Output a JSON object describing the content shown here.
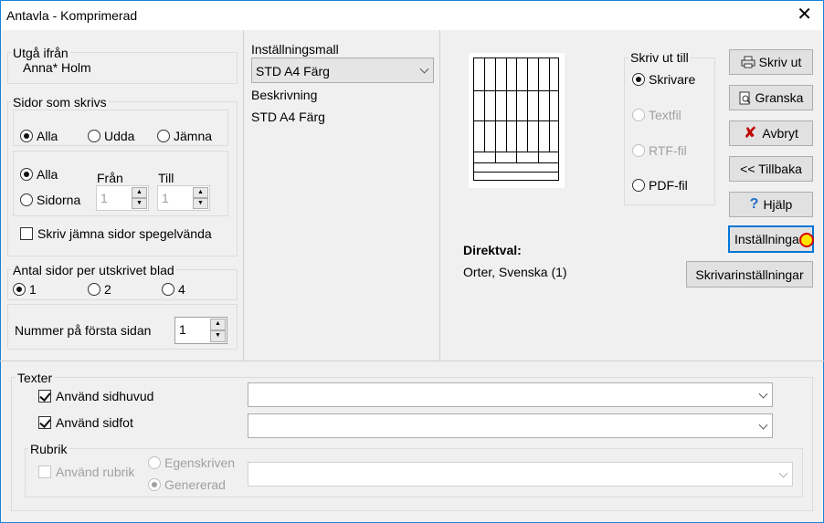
{
  "window": {
    "title": "Antavla - Komprimerad"
  },
  "source": {
    "label": "Utgå ifrån",
    "value": "Anna* Holm"
  },
  "pages": {
    "label": "Sidor som skrivs",
    "parity_options": [
      "Alla",
      "Udda",
      "Jämna"
    ],
    "range_all": "Alla",
    "range_pages": "Sidorna",
    "from_label": "Från",
    "from_value": "1",
    "to_label": "Till",
    "to_value": "1",
    "mirror_label": "Skriv jämna sidor spegelvända"
  },
  "per_sheet": {
    "label": "Antal sidor per utskrivet blad",
    "options": [
      "1",
      "2",
      "4"
    ]
  },
  "first_page": {
    "label": "Nummer på första sidan",
    "value": "1"
  },
  "template": {
    "label": "Inställningsmall",
    "selected": "STD A4 Färg",
    "desc_label": "Beskrivning",
    "desc_value": "STD A4 Färg"
  },
  "output": {
    "label": "Skriv ut till",
    "options": [
      "Skrivare",
      "Textfil",
      "RTF-fil",
      "PDF-fil"
    ]
  },
  "directive": {
    "label": "Direktval:",
    "value": "Orter, Svenska (1)"
  },
  "buttons": {
    "print": "Skriv ut",
    "preview": "Granska",
    "cancel": "Avbryt",
    "back": "<< Tillbaka",
    "help": "Hjälp",
    "settings": "Inställningar",
    "printer_settings": "Skrivarinställningar"
  },
  "texts": {
    "label": "Texter",
    "header_label": "Använd sidhuvud",
    "header_value": "",
    "footer_label": "Använd sidfot",
    "footer_value": "",
    "rubrik_label": "Rubrik",
    "use_rubrik": "Använd rubrik",
    "custom": "Egenskriven",
    "generated": "Genererad"
  },
  "colors": {
    "accent": "#0078d7",
    "cancel_icon": "#c00000",
    "help_icon": "#1e6fc8"
  }
}
